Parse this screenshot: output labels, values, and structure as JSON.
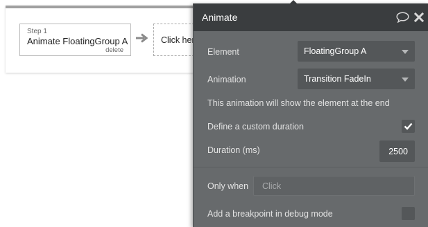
{
  "workflow": {
    "step": {
      "number_label": "Step 1",
      "title": "Animate FloatingGroup A",
      "delete_label": "delete"
    },
    "next_step": {
      "label": "Click her"
    }
  },
  "panel": {
    "title": "Animate",
    "icons": [
      "comment-icon",
      "close-icon"
    ],
    "element": {
      "label": "Element",
      "value": "FloatingGroup A"
    },
    "animation": {
      "label": "Animation",
      "value": "Transition FadeIn"
    },
    "note": "This animation will show the element at the end",
    "custom_duration": {
      "label": "Define a custom duration",
      "checked": true
    },
    "duration": {
      "label": "Duration (ms)",
      "value": "2500"
    },
    "only_when": {
      "label": "Only when",
      "placeholder": "Click"
    },
    "breakpoint": {
      "label": "Add a breakpoint in debug mode",
      "checked": false
    }
  },
  "colors": {
    "panel_bg": "#676a6c",
    "header_bg": "#3a3d3f",
    "field_bg": "#545759"
  }
}
